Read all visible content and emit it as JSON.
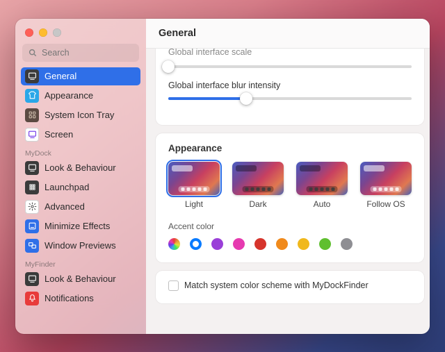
{
  "header": {
    "title": "General"
  },
  "search": {
    "placeholder": "Search"
  },
  "sidebar": {
    "primary": [
      {
        "label": "General",
        "icon": "screen",
        "bg": "#3b3b3b",
        "fg": "#fff",
        "active": true
      },
      {
        "label": "Appearance",
        "icon": "tshirt",
        "bg": "#2aa7e8",
        "fg": "#fff"
      },
      {
        "label": "System Icon Tray",
        "icon": "grid",
        "bg": "#5b4a42",
        "fg": "#cba"
      },
      {
        "label": "Screen",
        "icon": "screen",
        "bg": "#ffffff",
        "fg": "#6b2fe8",
        "ring": true
      }
    ],
    "sections": [
      {
        "title": "MyDock",
        "items": [
          {
            "label": "Look & Behaviour",
            "icon": "screen",
            "bg": "#3b3b3b",
            "fg": "#fff"
          },
          {
            "label": "Launchpad",
            "icon": "grid2",
            "bg": "#3b3b3b",
            "fg": "#ddd"
          },
          {
            "label": "Advanced",
            "icon": "gear",
            "bg": "#ffffff",
            "fg": "#555",
            "ring": true
          },
          {
            "label": "Minimize Effects",
            "icon": "minimize",
            "bg": "#2f6fe8",
            "fg": "#fff"
          },
          {
            "label": "Window Previews",
            "icon": "previews",
            "bg": "#2f6fe8",
            "fg": "#fff"
          }
        ]
      },
      {
        "title": "MyFinder",
        "items": [
          {
            "label": "Look & Behaviour",
            "icon": "screen",
            "bg": "#3b3b3b",
            "fg": "#fff"
          },
          {
            "label": "Notifications",
            "icon": "bell",
            "bg": "#e83b3b",
            "fg": "#fff"
          }
        ]
      }
    ]
  },
  "main": {
    "scale_label": "Global interface scale",
    "scale_value": 0,
    "blur_label": "Global interface blur intensity",
    "blur_value": 32,
    "appearance_title": "Appearance",
    "themes": [
      {
        "label": "Light",
        "variant": "light",
        "selected": true
      },
      {
        "label": "Dark",
        "variant": "dark",
        "selected": false
      },
      {
        "label": "Auto",
        "variant": "dark",
        "selected": false
      },
      {
        "label": "Follow OS",
        "variant": "light",
        "selected": false
      }
    ],
    "accent_label": "Accent color",
    "accents": [
      {
        "color": "conic-gradient(#e83b3b,#e8a23b,#e8e03b,#3be85a,#3ba7e8,#6b3be8,#e83bb0,#e83b3b)",
        "selected": false
      },
      {
        "color": "#0a7bff",
        "selected": true
      },
      {
        "color": "#9a3fd8",
        "selected": false
      },
      {
        "color": "#e63ab0",
        "selected": false
      },
      {
        "color": "#d6342c",
        "selected": false
      },
      {
        "color": "#f08a1c",
        "selected": false
      },
      {
        "color": "#f0b81c",
        "selected": false
      },
      {
        "color": "#5fbf2f",
        "selected": false
      },
      {
        "color": "#8e8e93",
        "selected": false
      }
    ],
    "match_label": "Match system color scheme with MyDockFinder",
    "match_checked": false
  }
}
